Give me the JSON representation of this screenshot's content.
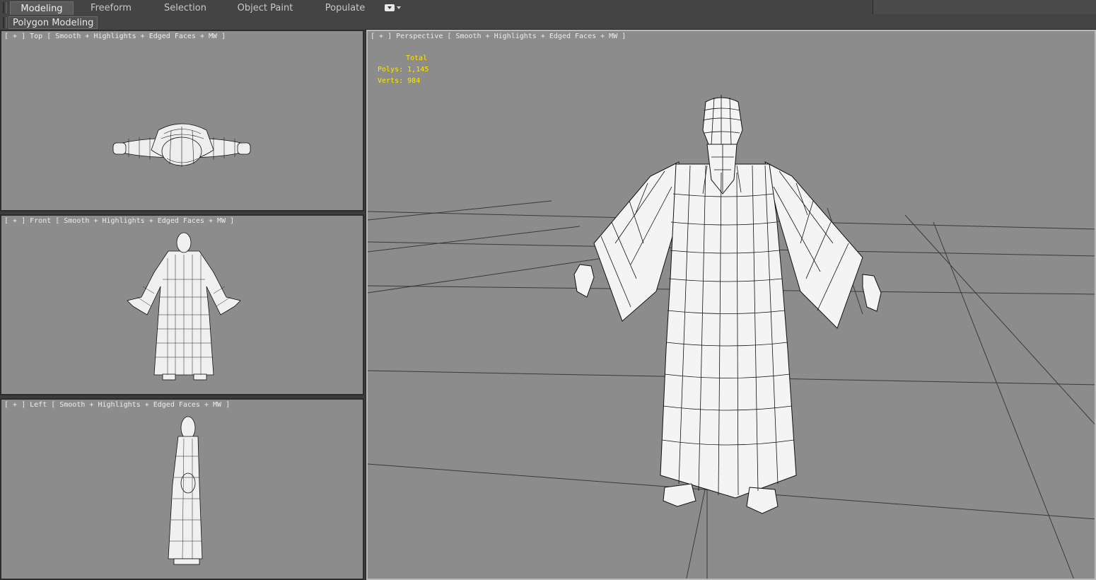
{
  "ribbon": {
    "tabs": [
      {
        "label": "Modeling",
        "active": true
      },
      {
        "label": "Freeform",
        "active": false
      },
      {
        "label": "Selection",
        "active": false
      },
      {
        "label": "Object Paint",
        "active": false
      },
      {
        "label": "Populate",
        "active": false
      }
    ],
    "panel_label": "Polygon Modeling"
  },
  "viewports": {
    "top": {
      "plus": "[ + ]",
      "view": "Top",
      "shading": "Smooth + Highlights + Edged Faces + MW ]"
    },
    "front": {
      "plus": "[ + ]",
      "view": "Front",
      "shading": "Smooth + Highlights + Edged Faces + MW ]"
    },
    "left": {
      "plus": "[ + ]",
      "view": "Left",
      "shading": "Smooth + Highlights + Edged Faces + MW ]"
    },
    "perspective": {
      "plus": "[ + ]",
      "view": "Perspective",
      "shading": "Smooth + Highlights + Edged Faces + MW ]",
      "stats": {
        "total_label": "Total",
        "polys_label": "Polys:",
        "polys_value": "1,145",
        "verts_label": "Verts:",
        "verts_value": "984"
      }
    }
  },
  "colors": {
    "viewport_bg": "#8c8c8c",
    "stats_text": "#ffe600",
    "mesh_fill": "#f2f2f2",
    "wire": "#111111",
    "grid_line": "#3a3a3a"
  },
  "icons": {
    "ribbon_dropdown": "dropdown-arrow-icon"
  }
}
